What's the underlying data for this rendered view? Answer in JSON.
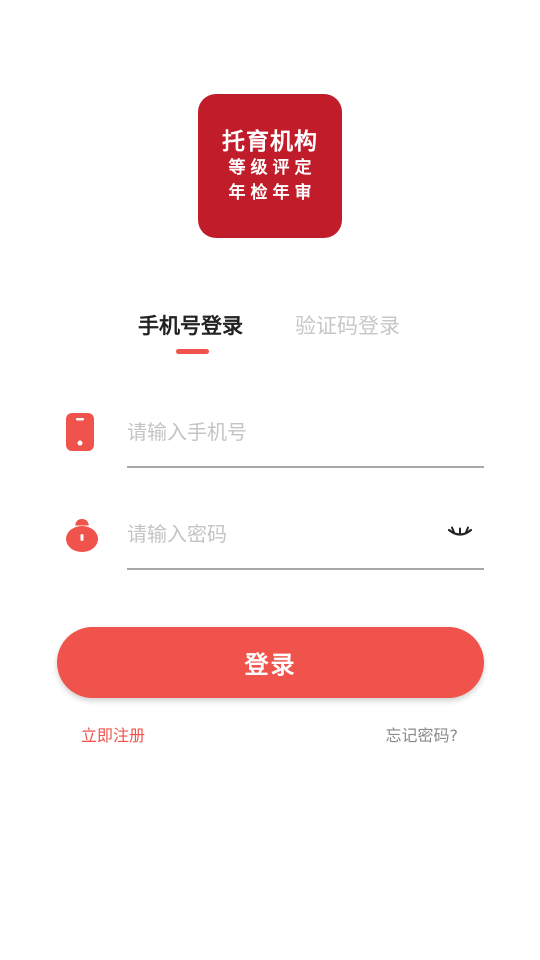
{
  "logo": {
    "line1": "托育机构",
    "line2": "等级评定",
    "line3": "年检年审"
  },
  "tabs": [
    {
      "label": "手机号登录",
      "active": true
    },
    {
      "label": "验证码登录",
      "active": false
    }
  ],
  "phone_field": {
    "placeholder": "请输入手机号",
    "value": "",
    "icon": "phone-icon"
  },
  "password_field": {
    "placeholder": "请输入密码",
    "value": "",
    "icon": "lock-icon",
    "toggle_icon": "eye-closed-icon"
  },
  "login_button": "登录",
  "register_link": "立即注册",
  "forgot_link": "忘记密码?",
  "colors": {
    "accent": "#ef534b",
    "logo_bg": "#c11c2a",
    "tab_inactive": "#c7c7c7",
    "placeholder": "#c4c4c4",
    "muted_text": "#8a8a8a"
  }
}
